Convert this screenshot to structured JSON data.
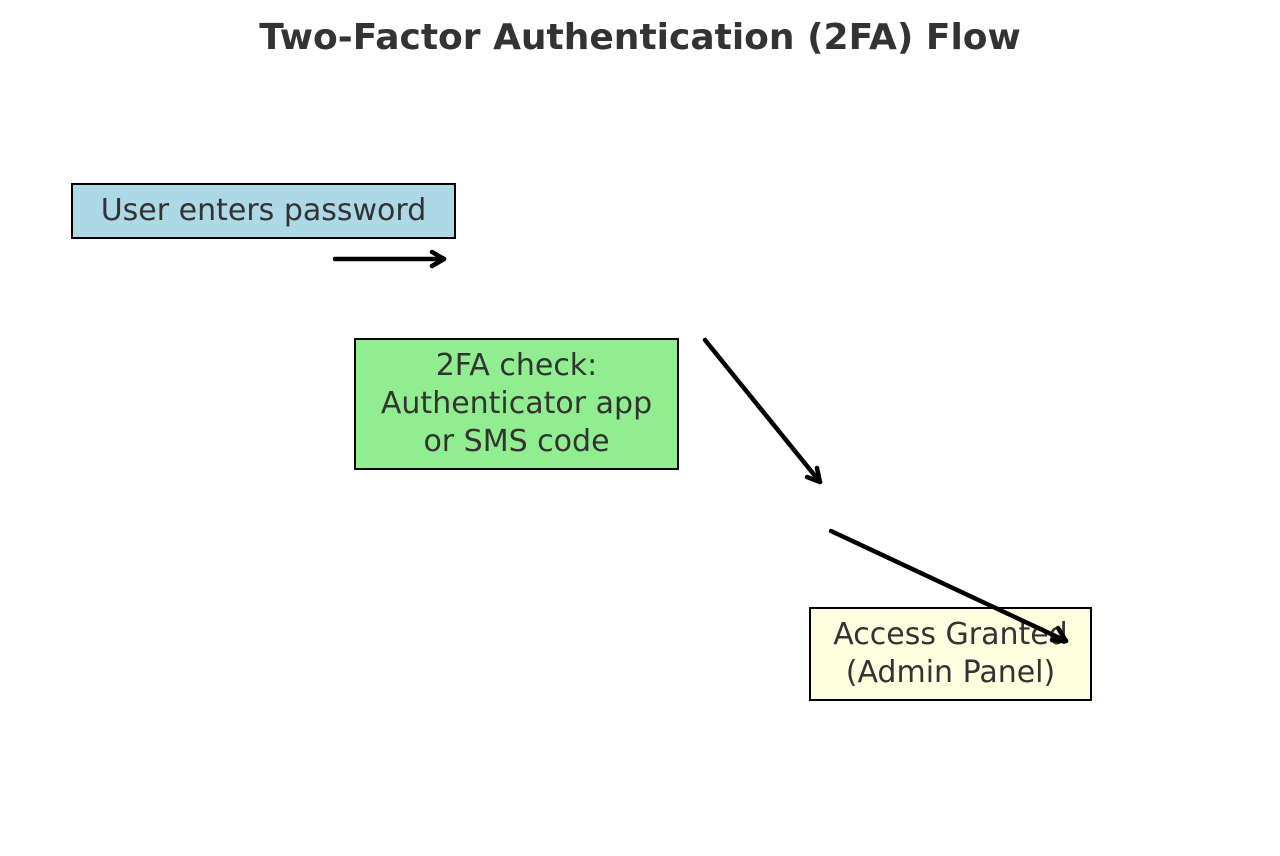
{
  "diagram": {
    "title": "Two-Factor Authentication (2FA) Flow",
    "nodes": {
      "password": {
        "label": "User enters password",
        "fill": "#add8e6"
      },
      "twofa": {
        "label": "2FA check:\nAuthenticator app\nor SMS code",
        "fill": "#90ee90"
      },
      "access": {
        "label": "Access Granted\n(Admin Panel)",
        "fill": "#ffffe0"
      }
    },
    "arrow_color": "#000000"
  }
}
